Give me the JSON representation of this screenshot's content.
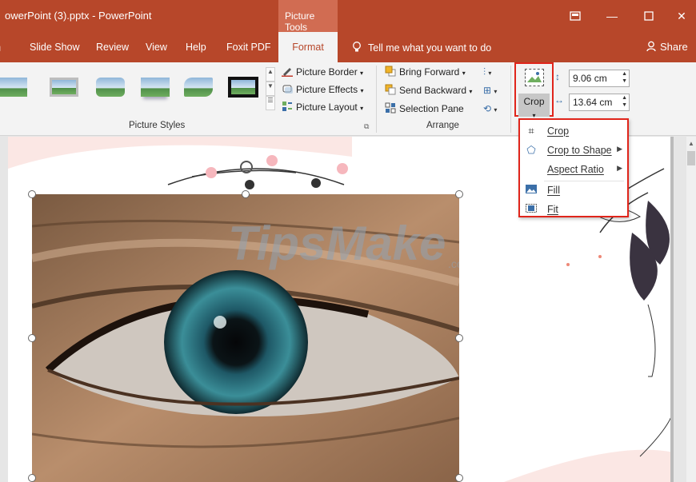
{
  "window": {
    "title": "owerPoint (3).pptx  -  PowerPoint",
    "context_tab": "Picture Tools"
  },
  "tabs": {
    "items": [
      "Slide Show",
      "Review",
      "View",
      "Help",
      "Foxit PDF"
    ],
    "active": "Format",
    "tell_me": "Tell me what you want to do",
    "share": "Share"
  },
  "ribbon": {
    "picture_border": "Picture Border",
    "picture_effects": "Picture Effects",
    "picture_layout": "Picture Layout",
    "picture_styles_label": "Picture Styles",
    "bring_forward": "Bring Forward",
    "send_backward": "Send Backward",
    "selection_pane": "Selection Pane",
    "arrange_label": "Arrange",
    "crop_label": "Crop",
    "height_value": "9.06 cm",
    "width_value": "13.64 cm"
  },
  "crop_menu": {
    "items": [
      {
        "label": "Crop",
        "icon": "crop-icon",
        "submenu": false
      },
      {
        "label": "Crop to Shape",
        "icon": "crop-to-shape-icon",
        "submenu": true
      },
      {
        "label": "Aspect Ratio",
        "icon": "",
        "submenu": true
      },
      {
        "label": "Fill",
        "icon": "fill-icon",
        "submenu": false
      },
      {
        "label": "Fit",
        "icon": "fit-icon",
        "submenu": false
      }
    ]
  },
  "slide": {
    "watermark": "TipsMake",
    "watermark_suffix": ".com"
  },
  "colors": {
    "accent": "#b7472a",
    "highlight": "#e0251b"
  }
}
